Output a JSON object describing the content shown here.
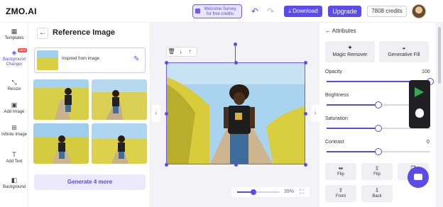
{
  "header": {
    "logo": "ZMO.AI",
    "survey_line1": "Welcome Survey",
    "survey_line2": "for free credits",
    "download_label": "Download",
    "upgrade_label": "Upgrade",
    "credits": "7808 credits"
  },
  "rail": {
    "items": [
      {
        "label": "Templates",
        "icon": "templates-icon"
      },
      {
        "label": "Background Changer",
        "icon": "background-changer-icon",
        "badge": "NEW"
      },
      {
        "label": "Resize",
        "icon": "resize-icon"
      },
      {
        "label": "Add Image",
        "icon": "image-icon"
      },
      {
        "label": "Infinite Image",
        "icon": "infinite-image-icon"
      },
      {
        "label": "Add Text",
        "icon": "text-icon"
      },
      {
        "label": "Background",
        "icon": "background-icon"
      }
    ]
  },
  "reference": {
    "title": "Reference Image",
    "inspired_label": "Inspired from image",
    "generate_label": "Generate 4 more"
  },
  "canvas": {
    "zoom_percent": "39%",
    "zoom_level": 0.39
  },
  "attributes": {
    "title": "Attributes",
    "magic_remover": "Magic Remover",
    "generative_fill": "Generative Fill",
    "sliders": [
      {
        "label": "Opacity",
        "value": "100",
        "fraction": 1.0
      },
      {
        "label": "Brightness",
        "value": "",
        "fraction": 0.5
      },
      {
        "label": "Saturation",
        "value": "",
        "fraction": 0.5
      },
      {
        "label": "Contrast",
        "value": "0",
        "fraction": 0.5
      }
    ],
    "buttons_row1": [
      "Flip",
      "Flip",
      "D"
    ],
    "buttons_row2": [
      "Front",
      "Back"
    ]
  },
  "colors": {
    "accent": "#5b4be8",
    "field": "#d9cf43",
    "sky": "#9ed0ef"
  }
}
